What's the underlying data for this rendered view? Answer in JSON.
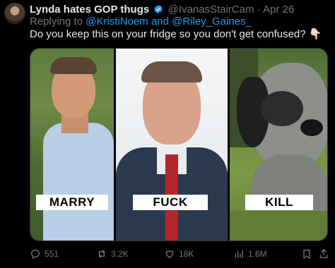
{
  "tweet": {
    "display_name": "Lynda hates GOP thugs",
    "handle_date": "@IvanasStairCam · Apr 26",
    "replying_prefix": "Replying to",
    "replying_users": "@KristiNoem and @Riley_Gaines_",
    "text": "Do you keep this on your fridge so you don't get confused? 👇🏻"
  },
  "media": {
    "labels": [
      "MARRY",
      "FUCK",
      "KILL"
    ]
  },
  "actions": {
    "replies": "551",
    "reposts": "3.2K",
    "likes": "18K",
    "views": "1.6M"
  },
  "icons": {
    "verified": "verified-badge-icon",
    "reply": "reply-icon",
    "repost": "repost-icon",
    "like": "heart-icon",
    "views": "views-icon",
    "bookmark": "bookmark-icon",
    "share": "share-icon"
  },
  "colors": {
    "background": "#000000",
    "link": "#1d9bf0",
    "muted": "#71767b"
  }
}
